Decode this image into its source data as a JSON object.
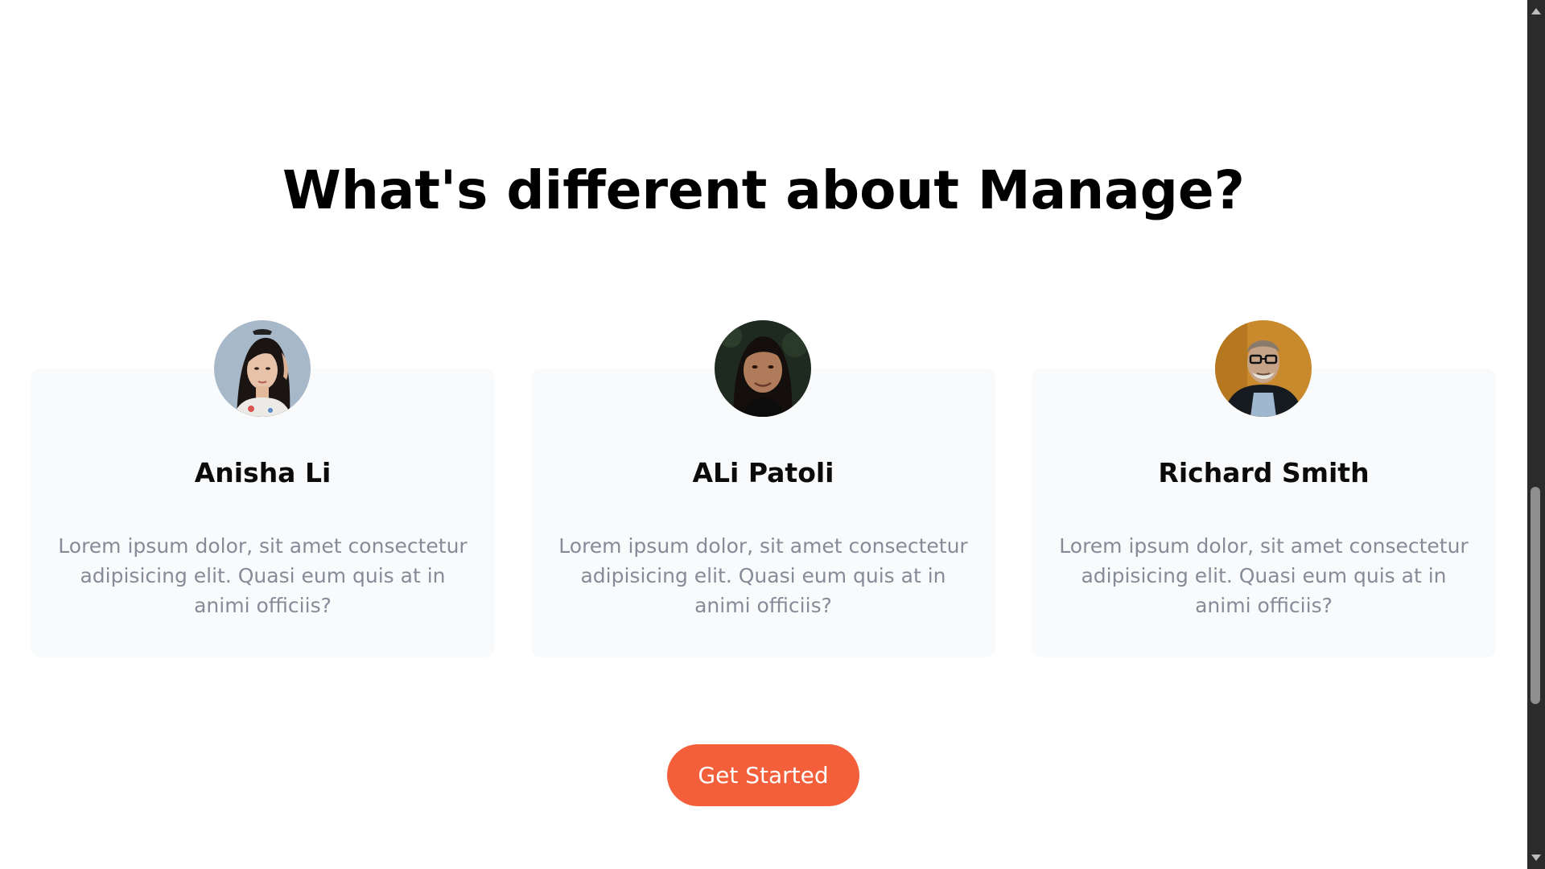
{
  "section": {
    "heading": "What's different about Manage?"
  },
  "testimonials": [
    {
      "name": "Anisha Li",
      "quote": "Lorem ipsum dolor, sit amet consectetur adipisicing elit. Quasi eum quis at in animi officiis?",
      "avatar_icon": "avatar-woman-long-dark-hair"
    },
    {
      "name": "ALi Patoli",
      "quote": "Lorem ipsum dolor, sit amet consectetur adipisicing elit. Quasi eum quis at in animi officiis?",
      "avatar_icon": "avatar-woman-smiling"
    },
    {
      "name": "Richard Smith",
      "quote": "Lorem ipsum dolor, sit amet consectetur adipisicing elit. Quasi eum quis at in animi officiis?",
      "avatar_icon": "avatar-older-man-glasses"
    }
  ],
  "cta": {
    "label": "Get Started"
  },
  "colors": {
    "accent": "#f25f3a",
    "card_background": "#f9fafb",
    "muted_text": "#868b98",
    "heading_text": "#000000",
    "scrollbar_track": "#2b2b2b",
    "scrollbar_thumb": "#8e8e8e"
  }
}
